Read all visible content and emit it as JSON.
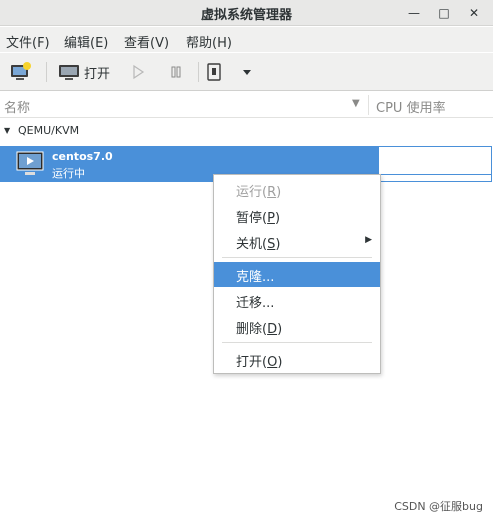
{
  "window": {
    "title": "虚拟系统管理器",
    "minimize_glyph": "—",
    "maximize_glyph": "□",
    "close_glyph": "✕"
  },
  "menubar": {
    "items": [
      "文件(F)",
      "编辑(E)",
      "查看(V)",
      "帮助(H)"
    ]
  },
  "toolbar": {
    "open_label": "打开",
    "icons": [
      "new-vm-icon",
      "monitor-icon",
      "play-icon",
      "pause-icon",
      "shutdown-icon",
      "dropdown-arrow-icon"
    ]
  },
  "columns": {
    "name": "名称",
    "cpu": "CPU 使用率"
  },
  "connection": {
    "label": "QEMU/KVM"
  },
  "vm": {
    "name": "centos7.0",
    "status": "运行中"
  },
  "context_menu": {
    "run": {
      "label": "运行",
      "mnemonic": "R"
    },
    "pause": {
      "label": "暂停",
      "mnemonic": "P"
    },
    "shutdown": {
      "label": "关机",
      "mnemonic": "S"
    },
    "clone": {
      "label": "克隆..."
    },
    "migrate": {
      "label": "迁移..."
    },
    "delete": {
      "label": "删除",
      "mnemonic": "D"
    },
    "open": {
      "label": "打开",
      "mnemonic": "O"
    }
  },
  "watermark": "CSDN @征服bug",
  "colors": {
    "selection": "#4a90d9",
    "chrome": "#f0f0ef",
    "disabled_text": "#a0a0a0"
  }
}
